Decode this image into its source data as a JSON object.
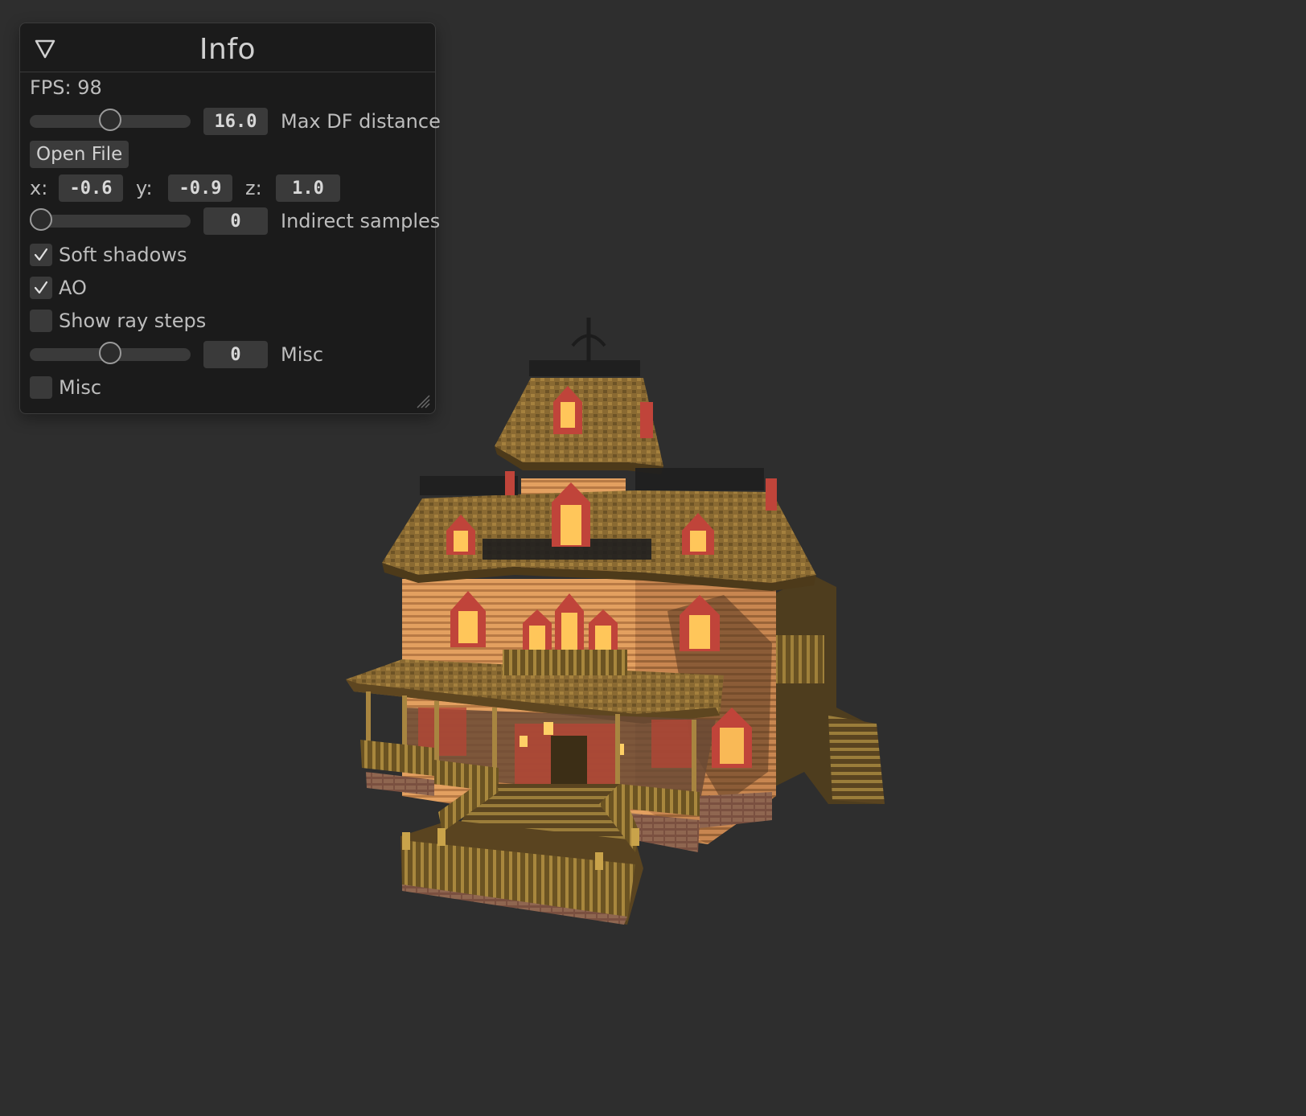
{
  "window": {
    "title": "Info",
    "fps_label": "FPS: 98",
    "max_df": {
      "value": "16.0",
      "label": "Max DF distance",
      "level": 0.5
    },
    "open_file_label": "Open File",
    "coords": {
      "x_label": "x:",
      "x_value": "-0.6",
      "y_label": "y:",
      "y_value": "-0.9",
      "z_label": "z:",
      "z_value": "1.0"
    },
    "indirect": {
      "value": "0",
      "label": "Indirect samples",
      "level": 0.0
    },
    "soft_shadows": {
      "label": "Soft shadows",
      "checked": true
    },
    "ao": {
      "label": "AO",
      "checked": true
    },
    "show_ray_steps": {
      "label": "Show ray steps",
      "checked": false
    },
    "misc_slider": {
      "value": "0",
      "label": "Misc",
      "level": 0.5
    },
    "misc_checkbox": {
      "label": "Misc",
      "checked": false
    }
  },
  "colors": {
    "background": "#2e2e2e",
    "panel": "#1b1b1b",
    "wall": "#e8a060",
    "roof": "#8a6a30",
    "trim": "#c04a3a",
    "window_glow": "#ffc85a",
    "railing": "#2a2a2a"
  },
  "icons": {
    "collapse": "triangle-down-icon",
    "check": "checkmark-icon",
    "resize": "resize-grip-icon"
  }
}
